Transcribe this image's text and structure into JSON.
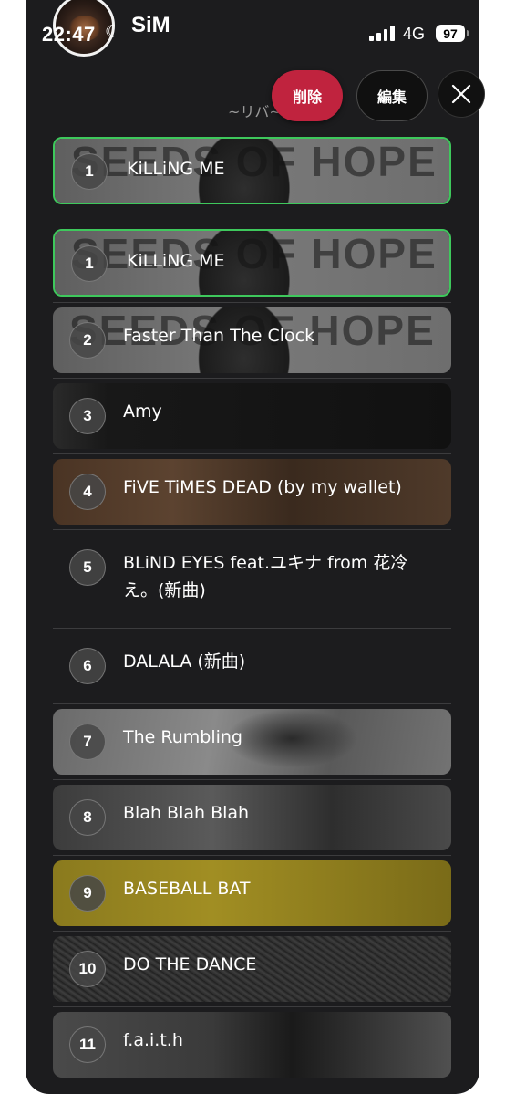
{
  "status_bar": {
    "time": "22:47",
    "network": "4G",
    "battery": "97"
  },
  "header": {
    "artist_name": "SiM",
    "list_title": "~リバ~",
    "delete_label": "削除",
    "edit_label": "編集"
  },
  "tracks": [
    {
      "number": "1",
      "title": "KiLLiNG ME",
      "selected": true
    },
    {
      "number": "1",
      "title": "KiLLiNG ME",
      "selected": true
    },
    {
      "number": "2",
      "title": "Faster Than The Clock"
    },
    {
      "number": "3",
      "title": "Amy"
    },
    {
      "number": "4",
      "title": "FiVE TiMES DEAD (by my wallet)"
    },
    {
      "number": "5",
      "title": "BLiND EYES feat.ユキナ from 花冷え。(新曲)"
    },
    {
      "number": "6",
      "title": "DALALA (新曲)"
    },
    {
      "number": "7",
      "title": "The Rumbling"
    },
    {
      "number": "8",
      "title": "Blah Blah Blah"
    },
    {
      "number": "9",
      "title": "BASEBALL BAT"
    },
    {
      "number": "10",
      "title": "DO THE DANCE"
    },
    {
      "number": "11",
      "title": "f.a.i.t.h"
    }
  ],
  "artwork_text": "SEEDS OF HOPE",
  "colors": {
    "panel": "#1c1c1e",
    "delete": "#c0233e",
    "selected_border": "#3ec85c"
  }
}
